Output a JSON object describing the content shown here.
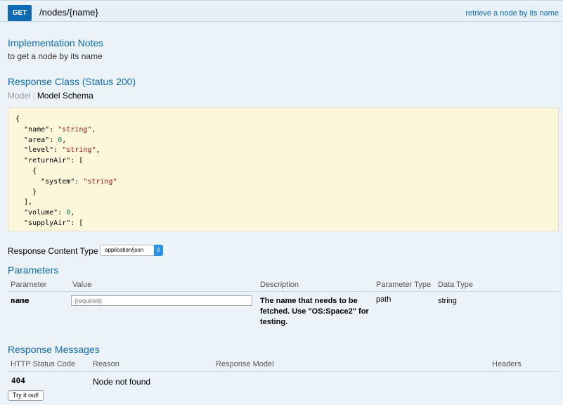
{
  "operation": {
    "method": "GET",
    "path": "/nodes/{name}",
    "summary": "retrieve a node by its name"
  },
  "implementation_notes": {
    "title": "Implementation Notes",
    "text": "to get a node by its name"
  },
  "response_class": {
    "title": "Response Class (Status 200)",
    "tab_model": "Model",
    "tab_schema": "Model Schema",
    "schema_lines": [
      "{",
      "  \"name\": \"string\",",
      "  \"area\": 0,",
      "  \"level\": \"string\",",
      "  \"returnAir\": [",
      "    {",
      "      \"system\": \"string\"",
      "    }",
      "  ],",
      "  \"volume\": 0,",
      "  \"supplyAir\": ["
    ]
  },
  "response_content_type": {
    "label": "Response Content Type",
    "value": "application/json"
  },
  "parameters": {
    "title": "Parameters",
    "headers": [
      "Parameter",
      "Value",
      "Description",
      "Parameter Type",
      "Data Type"
    ],
    "rows": [
      {
        "name": "name",
        "placeholder": "(required)",
        "description": "The name that needs to be fetched. Use \"OS:Space2\" for testing.",
        "param_type": "path",
        "data_type": "string"
      }
    ]
  },
  "response_messages": {
    "title": "Response Messages",
    "headers": [
      "HTTP Status Code",
      "Reason",
      "Response Model",
      "Headers"
    ],
    "rows": [
      {
        "code": "404",
        "reason": "Node not found"
      }
    ]
  },
  "try_button": "Try it out!",
  "colors": {
    "get_badge": "#0f6ab4",
    "section_bg": "#ebf3f9",
    "schema_bg": "#fcf6db",
    "accent_text": "#0f6ab4"
  }
}
